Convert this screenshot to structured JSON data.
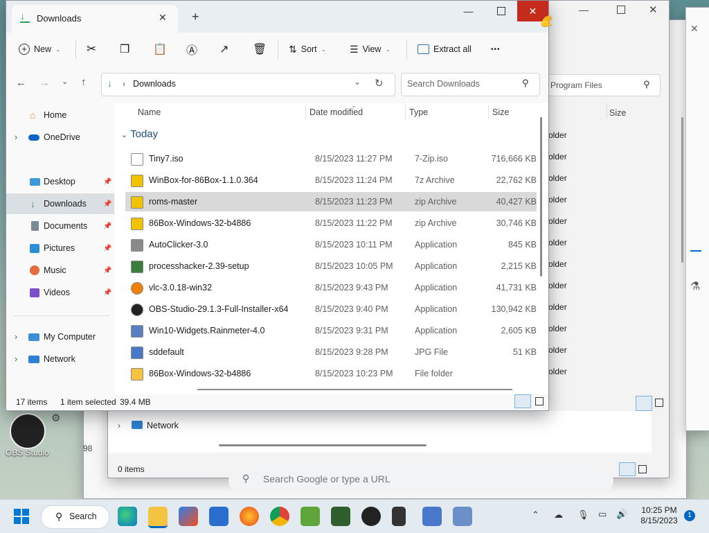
{
  "main_window": {
    "tab_title": "Downloads",
    "new_tab": "+",
    "toolbar": {
      "new_label": "New",
      "sort_label": "Sort",
      "view_label": "View",
      "extract_label": "Extract all",
      "more_label": "•••"
    },
    "breadcrumb": "Downloads",
    "search_placeholder": "Search Downloads",
    "nav": {
      "home": "Home",
      "onedrive": "OneDrive",
      "desktop": "Desktop",
      "downloads": "Downloads",
      "documents": "Documents",
      "pictures": "Pictures",
      "music": "Music",
      "videos": "Videos",
      "my_computer": "My Computer",
      "network": "Network"
    },
    "columns": {
      "name": "Name",
      "date": "Date modified",
      "type": "Type",
      "size": "Size"
    },
    "group": "Today",
    "files": [
      {
        "name": "Tiny7.iso",
        "date": "8/15/2023 11:27 PM",
        "type": "7-Zip.iso",
        "size": "716,666 KB",
        "icon": "file-icon",
        "color": "#ffffff"
      },
      {
        "name": "WinBox-for-86Box-1.1.0.364",
        "date": "8/15/2023 11:24 PM",
        "type": "7z Archive",
        "size": "22,762 KB",
        "icon": "archive-icon",
        "color": "#f2c200"
      },
      {
        "name": "roms-master",
        "date": "8/15/2023 11:23 PM",
        "type": "zip Archive",
        "size": "40,427 KB",
        "icon": "archive-icon",
        "color": "#f2c200"
      },
      {
        "name": "86Box-Windows-32-b4886",
        "date": "8/15/2023 11:22 PM",
        "type": "zip Archive",
        "size": "30,746 KB",
        "icon": "archive-icon",
        "color": "#f2c200"
      },
      {
        "name": "AutoClicker-3.0",
        "date": "8/15/2023 10:11 PM",
        "type": "Application",
        "size": "845 KB",
        "icon": "mouse-icon",
        "color": "#8a8a8a"
      },
      {
        "name": "processhacker-2.39-setup",
        "date": "8/15/2023 10:05 PM",
        "type": "Application",
        "size": "2,215 KB",
        "icon": "monitor-icon",
        "color": "#3b7d3b"
      },
      {
        "name": "vlc-3.0.18-win32",
        "date": "8/15/2023 9:43 PM",
        "type": "Application",
        "size": "41,731 KB",
        "icon": "vlc-icon",
        "color": "#f08000"
      },
      {
        "name": "OBS-Studio-29.1.3-Full-Installer-x64",
        "date": "8/15/2023 9:40 PM",
        "type": "Application",
        "size": "130,942 KB",
        "icon": "obs-icon",
        "color": "#222222"
      },
      {
        "name": "Win10-Widgets.Rainmeter-4.0",
        "date": "8/15/2023 9:31 PM",
        "type": "Application",
        "size": "2,605 KB",
        "icon": "setup-icon",
        "color": "#5a7fbf"
      },
      {
        "name": "sddefault",
        "date": "8/15/2023 9:28 PM",
        "type": "JPG File",
        "size": "51 KB",
        "icon": "image-icon",
        "color": "#4a78c8"
      },
      {
        "name": "86Box-Windows-32-b4886",
        "date": "8/15/2023 10:23 PM",
        "type": "File folder",
        "size": "",
        "icon": "folder-icon",
        "color": "#f5c342"
      }
    ],
    "status": {
      "count": "17 items",
      "selected": "1 item selected",
      "size": "39.4 MB"
    }
  },
  "background_window": {
    "search_placeholder": "n Program Files",
    "size_header": "Size",
    "folder_text": [
      "older",
      "older",
      "older",
      "older",
      "older",
      "older",
      "older",
      "older",
      "older",
      "older",
      "older",
      "older"
    ],
    "network": "Network",
    "items": "0 items",
    "left_fragment": "98"
  },
  "browser_fragment": {
    "placeholder": "Search Google or type a URL"
  },
  "desktop": {
    "obs_label": "OBS Studio"
  },
  "taskbar": {
    "search": "Search",
    "time": "10:25 PM",
    "date": "8/15/2023",
    "notif_count": "1"
  },
  "colors": {
    "accent": "#0067c0",
    "close_red": "#c42b1c",
    "download_green": "#2a9d5a"
  }
}
